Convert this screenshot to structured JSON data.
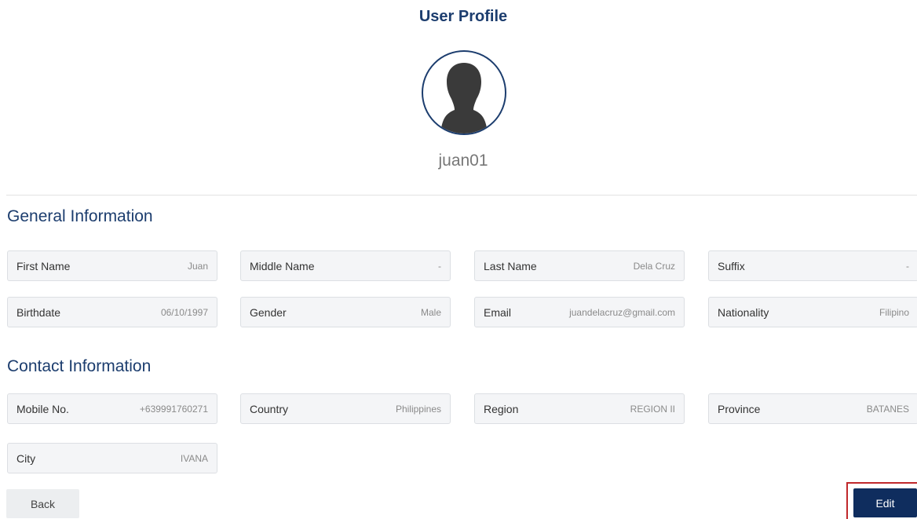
{
  "page": {
    "title": "User Profile"
  },
  "profile": {
    "username": "juan01"
  },
  "general": {
    "title": "General Information",
    "fields": [
      {
        "label": "First Name",
        "value": "Juan"
      },
      {
        "label": "Middle Name",
        "value": "-"
      },
      {
        "label": "Last Name",
        "value": "Dela Cruz"
      },
      {
        "label": "Suffix",
        "value": "-"
      },
      {
        "label": "Birthdate",
        "value": "06/10/1997"
      },
      {
        "label": "Gender",
        "value": "Male"
      },
      {
        "label": "Email",
        "value": "juandelacruz@gmail.com"
      },
      {
        "label": "Nationality",
        "value": "Filipino"
      }
    ]
  },
  "contact": {
    "title": "Contact Information",
    "fields": [
      {
        "label": "Mobile No.",
        "value": "+639991760271"
      },
      {
        "label": "Country",
        "value": "Philippines"
      },
      {
        "label": "Region",
        "value": "REGION II"
      },
      {
        "label": "Province",
        "value": "BATANES"
      },
      {
        "label": "City",
        "value": "IVANA"
      }
    ]
  },
  "actions": {
    "back_label": "Back",
    "edit_label": "Edit"
  },
  "colors": {
    "primary": "#1c3d6e",
    "button": "#0f2d5e",
    "highlight": "#c0282b"
  },
  "icons": {
    "avatar": "user-silhouette-icon"
  }
}
